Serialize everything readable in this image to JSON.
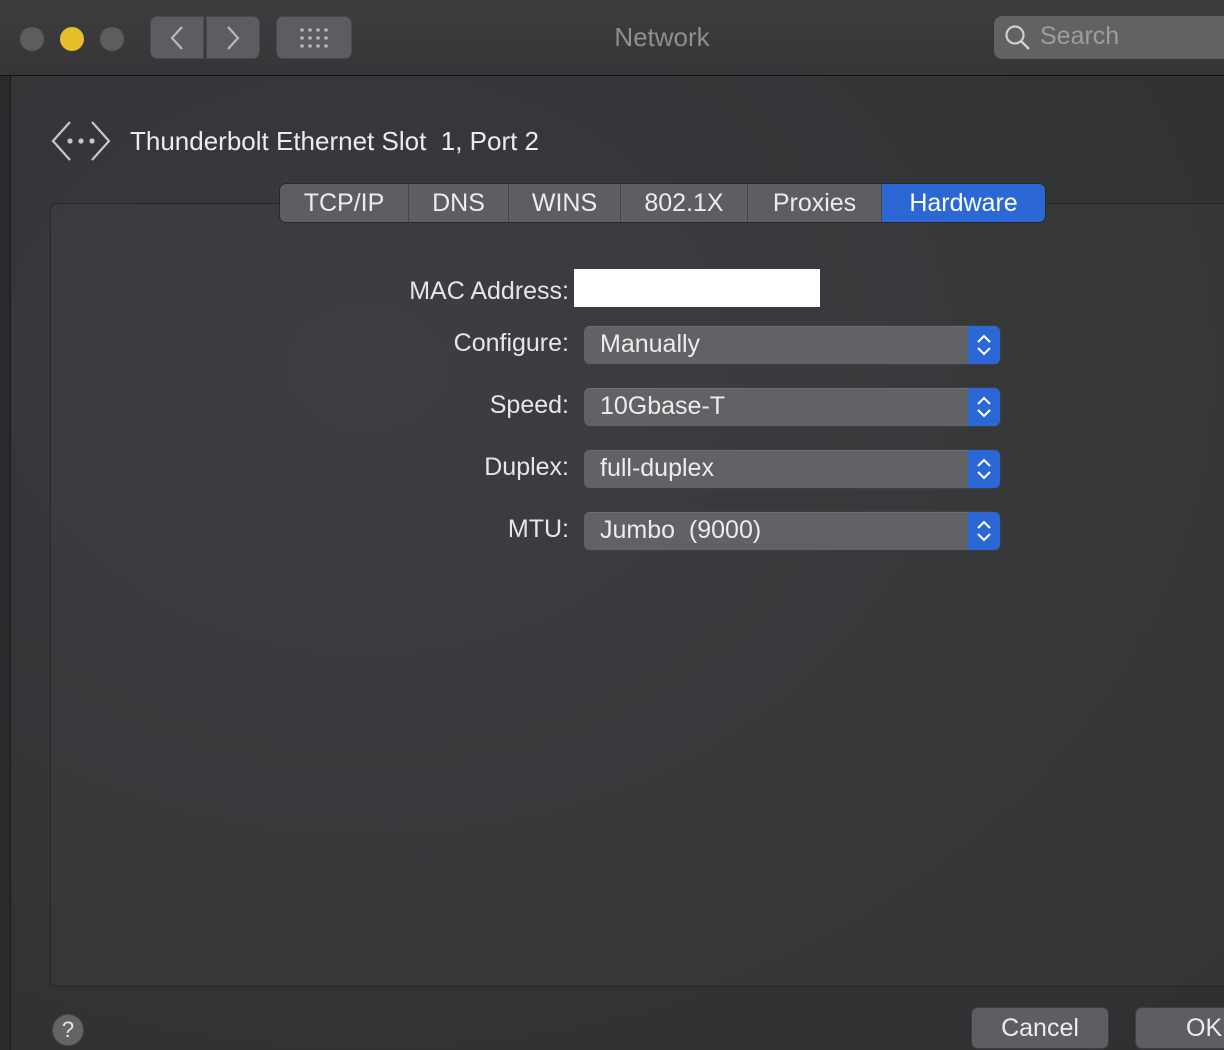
{
  "window": {
    "title": "Network",
    "search_placeholder": "Search"
  },
  "interface": {
    "name": "Thunderbolt Ethernet Slot  1, Port 2",
    "icon": "ethernet-arrows-icon"
  },
  "tabs": [
    {
      "label": "TCP/IP",
      "active": false
    },
    {
      "label": "DNS",
      "active": false
    },
    {
      "label": "WINS",
      "active": false
    },
    {
      "label": "802.1X",
      "active": false
    },
    {
      "label": "Proxies",
      "active": false
    },
    {
      "label": "Hardware",
      "active": true
    }
  ],
  "hardware": {
    "mac_label": "MAC Address:",
    "mac_value": "",
    "configure_label": "Configure:",
    "configure_value": "Manually",
    "speed_label": "Speed:",
    "speed_value": "10Gbase-T",
    "duplex_label": "Duplex:",
    "duplex_value": "full-duplex",
    "mtu_label": "MTU:",
    "mtu_value": "Jumbo  (9000)"
  },
  "footer": {
    "help_label": "?",
    "cancel_label": "Cancel",
    "ok_label": "OK"
  },
  "colors": {
    "accent": "#2c67d6",
    "minimize_light": "#e6c02c",
    "background": "#333436"
  }
}
